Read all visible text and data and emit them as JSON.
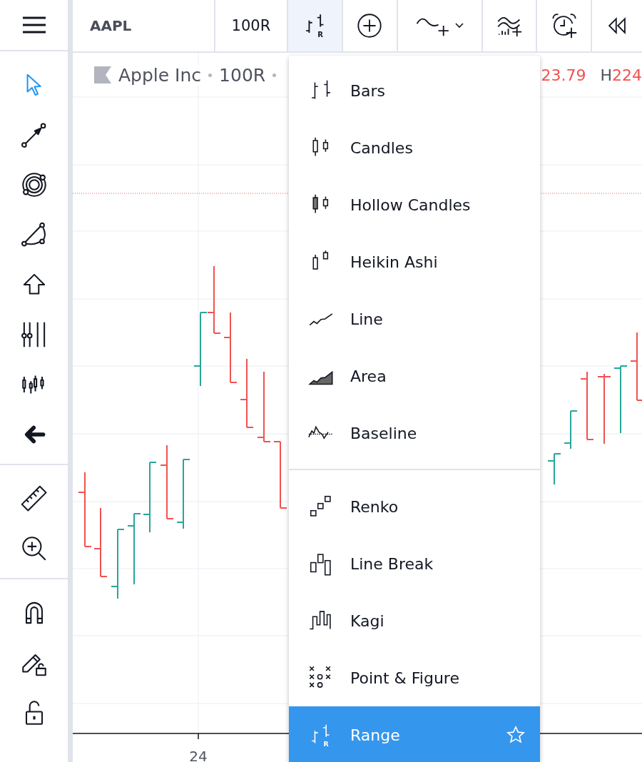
{
  "toolbar": {
    "items": [
      {
        "kind": "symbol",
        "label": "AAPL",
        "active": false
      },
      {
        "kind": "interval",
        "label": "100R",
        "active": false
      },
      {
        "kind": "chart-type",
        "badge": "R",
        "active": true
      },
      {
        "kind": "add",
        "active": false
      },
      {
        "kind": "indicators",
        "active": false
      },
      {
        "kind": "templates",
        "active": false
      },
      {
        "kind": "alert",
        "active": false
      },
      {
        "kind": "replay",
        "active": false
      }
    ]
  },
  "sidebar": {
    "groups": [
      [
        {
          "kind": "cursor",
          "selected": true
        },
        {
          "kind": "trend-line",
          "selected": false
        },
        {
          "kind": "circles",
          "selected": false
        },
        {
          "kind": "arc",
          "selected": false
        },
        {
          "kind": "arrow-up",
          "selected": false
        },
        {
          "kind": "sliders",
          "selected": false
        },
        {
          "kind": "patterns",
          "selected": false
        },
        {
          "kind": "back",
          "selected": false
        }
      ],
      [
        {
          "kind": "ruler",
          "selected": false
        },
        {
          "kind": "zoom",
          "selected": false
        }
      ],
      [
        {
          "kind": "magnet",
          "selected": false
        },
        {
          "kind": "pencil-lock",
          "selected": false
        },
        {
          "kind": "lock",
          "selected": false
        }
      ]
    ]
  },
  "legend": {
    "name": "Apple Inc",
    "interval": "100R",
    "value": "23.79",
    "high_label": "H",
    "high_value": "224"
  },
  "x_axis": {
    "labels": [
      "24"
    ]
  },
  "chart_type_menu": {
    "groups": [
      [
        {
          "label": "Bars",
          "kind": "bars",
          "selected": false
        },
        {
          "label": "Candles",
          "kind": "candles",
          "selected": false
        },
        {
          "label": "Hollow Candles",
          "kind": "hollow",
          "selected": false
        },
        {
          "label": "Heikin Ashi",
          "kind": "heikin",
          "selected": false
        },
        {
          "label": "Line",
          "kind": "line",
          "selected": false
        },
        {
          "label": "Area",
          "kind": "area",
          "selected": false
        },
        {
          "label": "Baseline",
          "kind": "baseline",
          "selected": false
        }
      ],
      [
        {
          "label": "Renko",
          "kind": "renko",
          "selected": false
        },
        {
          "label": "Line Break",
          "kind": "linebreak",
          "selected": false
        },
        {
          "label": "Kagi",
          "kind": "kagi",
          "selected": false
        },
        {
          "label": "Point & Figure",
          "kind": "pnf",
          "selected": false
        },
        {
          "label": "Range",
          "kind": "range",
          "badge": "R",
          "selected": true
        }
      ]
    ]
  }
}
